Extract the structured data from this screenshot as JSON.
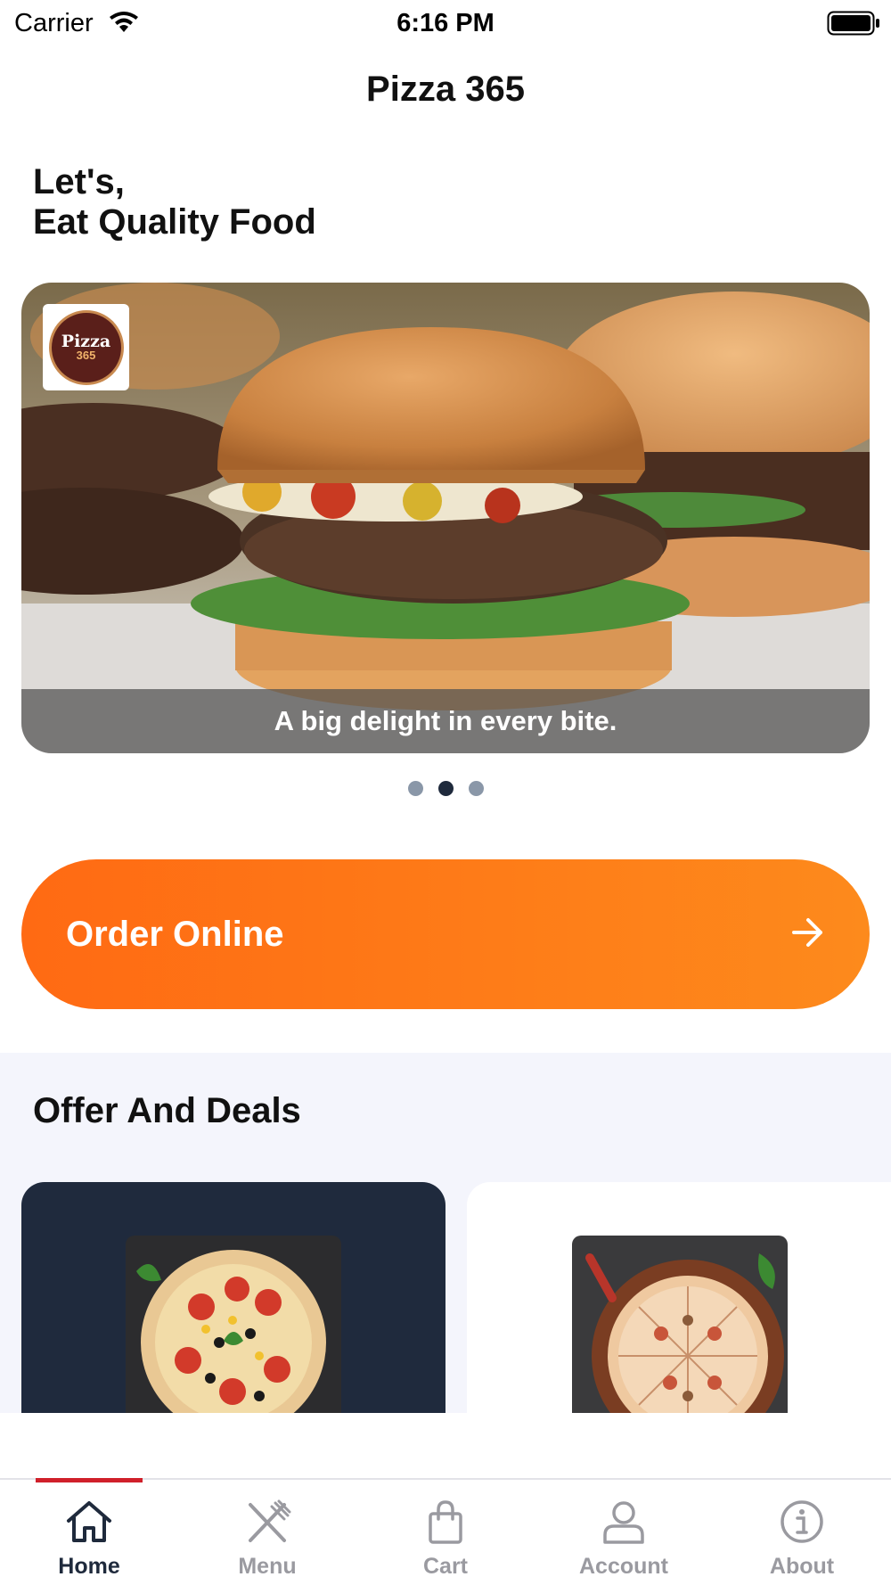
{
  "status_bar": {
    "carrier": "Carrier",
    "time": "6:16 PM"
  },
  "nav": {
    "title": "Pizza 365"
  },
  "greeting": {
    "line1": "Let's,",
    "line2": "Eat Quality Food"
  },
  "carousel": {
    "logo_text": "Pizza",
    "logo_number": "365",
    "caption": "A big delight in every bite.",
    "slide_count": 3,
    "active_index": 1
  },
  "order": {
    "label": "Order Online",
    "icon": "arrow-right-icon"
  },
  "offers": {
    "title": "Offer And Deals"
  },
  "tabs": [
    {
      "label": "Home",
      "icon": "home-icon",
      "active": true
    },
    {
      "label": "Menu",
      "icon": "fork-knife-icon",
      "active": false
    },
    {
      "label": "Cart",
      "icon": "shopping-bag-icon",
      "active": false
    },
    {
      "label": "Account",
      "icon": "user-icon",
      "active": false
    },
    {
      "label": "About",
      "icon": "info-icon",
      "active": false
    }
  ],
  "colors": {
    "accent_orange_start": "#ff6a13",
    "accent_orange_end": "#fd8a1c",
    "active_tab": "#1f2a3c",
    "tab_indicator": "#d0202a",
    "dark_card": "#1f2a3d",
    "section_bg": "#f4f5fc"
  }
}
